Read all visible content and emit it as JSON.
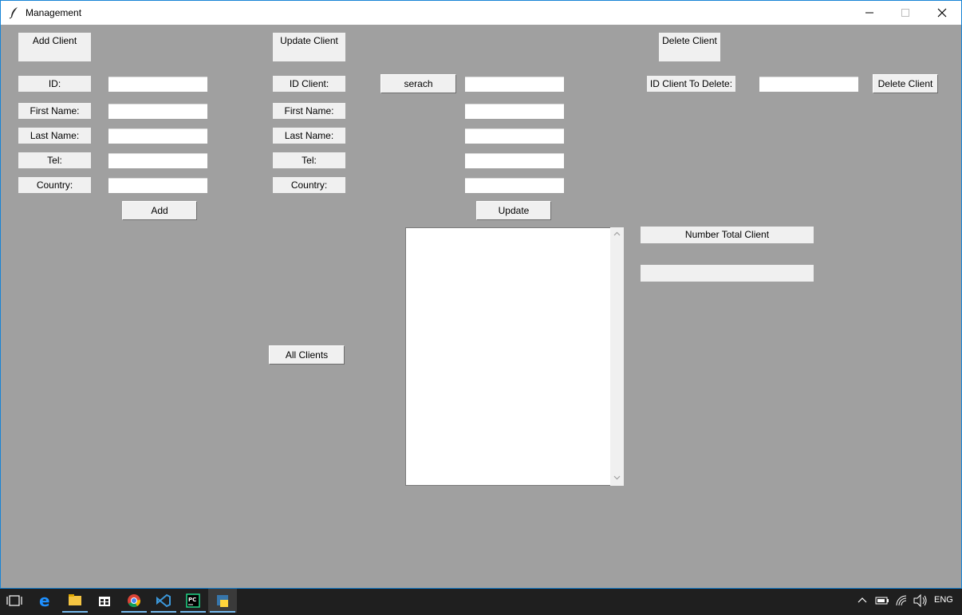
{
  "window": {
    "title": "Management",
    "colors": {
      "background": "#a0a0a0",
      "label_bg": "#f0f0f0",
      "titlebar": "#ffffff",
      "taskbar": "#1f1f1f"
    }
  },
  "add_section": {
    "header": "Add Client",
    "labels": {
      "id": "ID:",
      "first_name": "First Name:",
      "last_name": "Last Name:",
      "tel": "Tel:",
      "country": "Country:"
    },
    "button": "Add"
  },
  "update_section": {
    "header": "Update Client",
    "labels": {
      "id_client": "ID Client:",
      "first_name": "First Name:",
      "last_name": "Last Name:",
      "tel": "Tel:",
      "country": "Country:"
    },
    "search_button": "serach",
    "button": "Update",
    "all_clients_button": "All Clients"
  },
  "delete_section": {
    "header": "Delete Client",
    "id_label": "ID Client To Delete:",
    "button": "Delete Client"
  },
  "stats": {
    "label": "Number Total Client",
    "value": ""
  },
  "taskbar": {
    "icons": [
      "task-view-icon",
      "edge-icon",
      "file-explorer-icon",
      "store-icon",
      "chrome-icon",
      "vscode-icon",
      "pycharm-icon",
      "python-app-icon"
    ],
    "language": "ENG"
  }
}
